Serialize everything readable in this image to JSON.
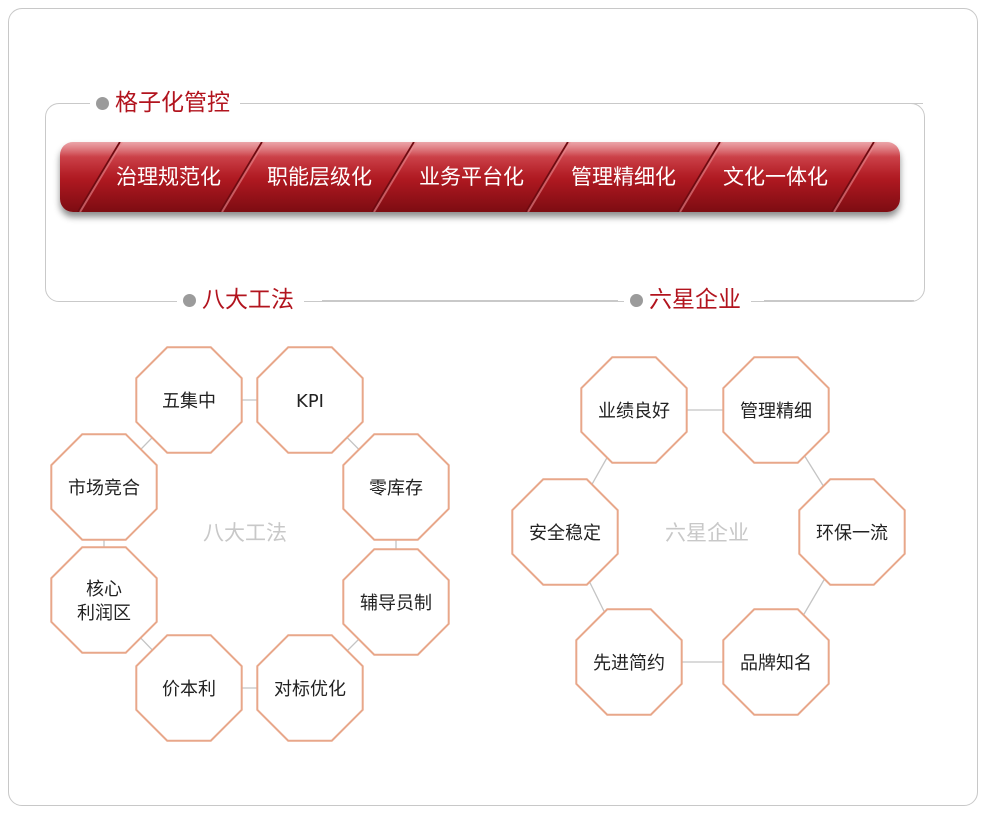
{
  "top": {
    "title": "格子化管控",
    "banner_items": [
      "治理规范化",
      "职能层级化",
      "业务平台化",
      "管理精细化",
      "文化一体化"
    ]
  },
  "eight": {
    "title": "八大工法",
    "center": "八大工法",
    "nodes": [
      "五集中",
      "KPI",
      "零库存",
      "辅导员制",
      "对标优化",
      "价本利",
      "核心\n利润区",
      "市场竞合"
    ]
  },
  "six": {
    "title": "六星企业",
    "center": "六星企业",
    "nodes": [
      "业绩良好",
      "管理精细",
      "环保一流",
      "品牌知名",
      "先进简约",
      "安全稳定"
    ]
  },
  "colors": {
    "accent_red": "#b2141e",
    "octagon_stroke": "#e8a78a",
    "connector": "#c4c4c4",
    "center_text": "#c8c8c8"
  }
}
